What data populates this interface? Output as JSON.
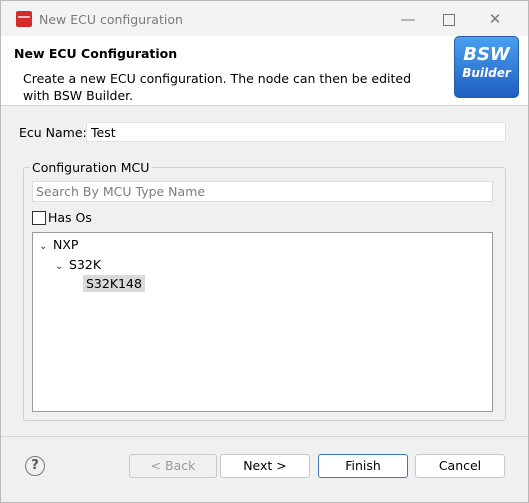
{
  "window": {
    "title": "New ECU configuration",
    "minimize": "—",
    "close": "✕"
  },
  "banner": {
    "title": "New ECU Configuration",
    "description": "Create a new ECU configuration. The node can then be edited with BSW Builder.",
    "logo_line1": "BSW",
    "logo_line2": "Builder"
  },
  "ecu": {
    "label": "Ecu Name:",
    "value": "Test"
  },
  "mcu": {
    "group_label": "Configuration MCU",
    "search_placeholder": "Search By MCU Type Name",
    "has_os_label": "Has Os",
    "has_os_checked": false,
    "tree": [
      {
        "label": "NXP",
        "expanded": true
      },
      {
        "label": "S32K",
        "expanded": true
      },
      {
        "label": "S32K148",
        "selected": true
      }
    ]
  },
  "buttons": {
    "back": "< Back",
    "next": "Next >",
    "finish": "Finish",
    "cancel": "Cancel",
    "help": "?"
  }
}
